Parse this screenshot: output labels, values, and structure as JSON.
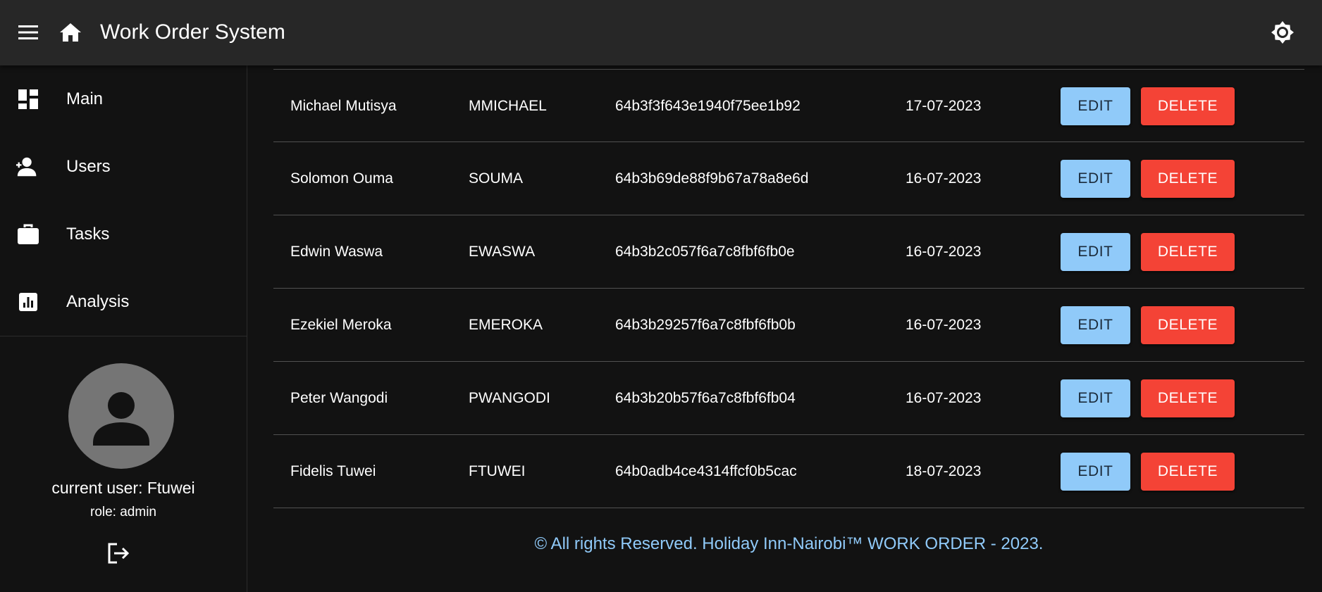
{
  "header": {
    "title": "Work Order System",
    "menu_icon": "menu-icon",
    "home_icon": "home-icon",
    "theme_icon": "brightness-icon"
  },
  "sidebar": {
    "items": [
      {
        "label": "Main",
        "icon": "dashboard-icon"
      },
      {
        "label": "Users",
        "icon": "person-add-icon"
      },
      {
        "label": "Tasks",
        "icon": "briefcase-icon"
      },
      {
        "label": "Analysis",
        "icon": "analytics-icon"
      }
    ],
    "current_user": "current user: Ftuwei",
    "role": "role: admin",
    "logout_icon": "logout-icon"
  },
  "table": {
    "rows": [
      {
        "name": "Michael Mutisya",
        "username": "MMICHAEL",
        "id": "64b3f3f643e1940f75ee1b92",
        "date": "17-07-2023",
        "edit": "EDIT",
        "delete": "DELETE"
      },
      {
        "name": "Solomon Ouma",
        "username": "SOUMA",
        "id": "64b3b69de88f9b67a78a8e6d",
        "date": "16-07-2023",
        "edit": "EDIT",
        "delete": "DELETE"
      },
      {
        "name": "Edwin Waswa",
        "username": "EWASWA",
        "id": "64b3b2c057f6a7c8fbf6fb0e",
        "date": "16-07-2023",
        "edit": "EDIT",
        "delete": "DELETE"
      },
      {
        "name": "Ezekiel Meroka",
        "username": "EMEROKA",
        "id": "64b3b29257f6a7c8fbf6fb0b",
        "date": "16-07-2023",
        "edit": "EDIT",
        "delete": "DELETE"
      },
      {
        "name": "Peter Wangodi",
        "username": "PWANGODI",
        "id": "64b3b20b57f6a7c8fbf6fb04",
        "date": "16-07-2023",
        "edit": "EDIT",
        "delete": "DELETE"
      },
      {
        "name": "Fidelis Tuwei",
        "username": "FTUWEI",
        "id": "64b0adb4ce4314ffcf0b5cac",
        "date": "18-07-2023",
        "edit": "EDIT",
        "delete": "DELETE"
      }
    ]
  },
  "footer": {
    "text": "© All rights Reserved. Holiday Inn-Nairobi™ WORK ORDER - 2023."
  },
  "colors": {
    "appbar": "#272727",
    "background": "#121212",
    "edit_button": "#90caf9",
    "delete_button": "#f44336",
    "footer_text": "#90caf9",
    "avatar": "#757575"
  }
}
